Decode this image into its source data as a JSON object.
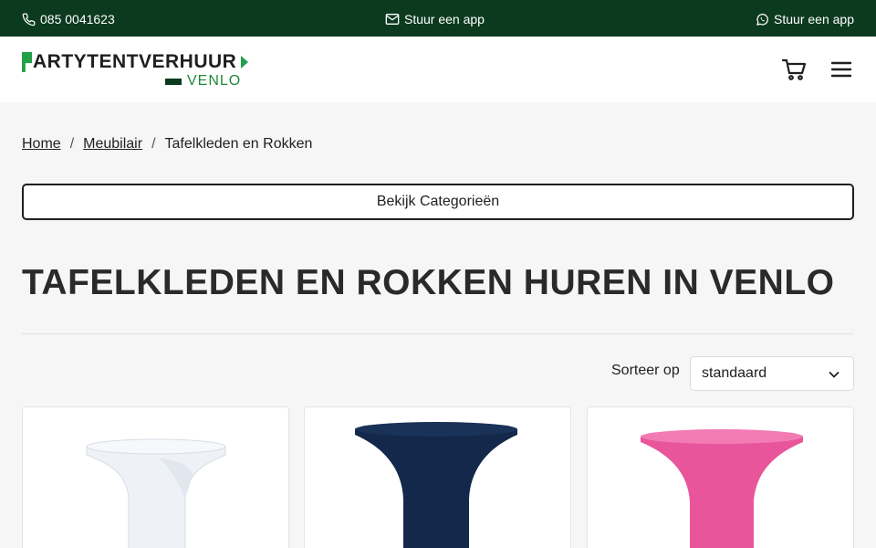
{
  "topbar": {
    "phone": "085 0041623",
    "mail_label": "Stuur een app",
    "whatsapp_label": "Stuur een app"
  },
  "logo": {
    "brand": "ARTYTENTVERHUUR",
    "city": "VENLO"
  },
  "colors": {
    "topbar_bg": "#0c3a1f",
    "accent_green": "#22a04a",
    "card_white": "#eef1f6",
    "card_navy": "#13284a",
    "card_pink": "#e9559b"
  },
  "icons": {
    "phone": "phone-icon",
    "mail": "mail-icon",
    "whatsapp": "whatsapp-icon",
    "cart": "cart-icon",
    "menu": "menu-icon",
    "chevron": "chevron-down-icon"
  },
  "breadcrumb": {
    "home": "Home",
    "sep1": "/",
    "category": "Meubilair",
    "sep2": "/",
    "current": "Tafelkleden en Rokken"
  },
  "categories_button": "Bekijk Categorieën",
  "page_title": "TAFELKLEDEN EN ROKKEN HUREN IN VENLO",
  "sort": {
    "label": "Sorteer op",
    "selected": "standaard"
  },
  "products": [
    {
      "color_name": "wit"
    },
    {
      "color_name": "navy"
    },
    {
      "color_name": "roze"
    }
  ]
}
